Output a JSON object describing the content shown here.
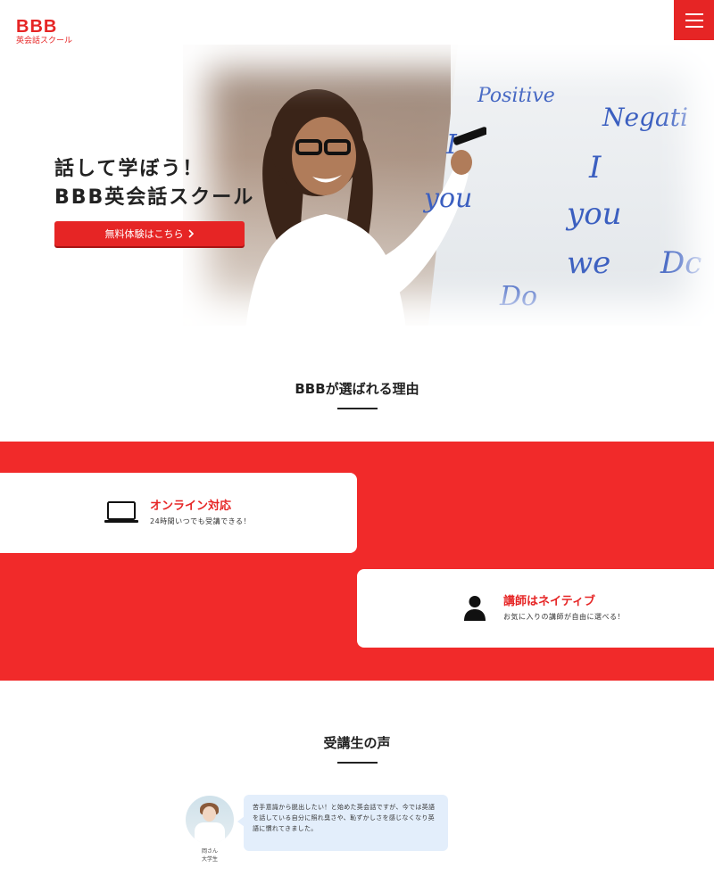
{
  "header": {
    "logo_main": "BBB",
    "logo_sub": "英会話スクール",
    "menu_icon": "hamburger-icon"
  },
  "colors": {
    "brand_red": "#e62525",
    "band_red": "#f12a2a",
    "bubble_blue": "#e3eefb"
  },
  "hero": {
    "title_line1": "話して学ぼう！",
    "title_line2": "BBB英会話スクール",
    "cta_label": "無料体験はこちら",
    "cta_icon": "chevron-right-icon"
  },
  "reasons": {
    "heading": "BBBが選ばれる理由",
    "items": [
      {
        "icon": "laptop-icon",
        "title": "オンライン対応",
        "desc": "24時間いつでも受講できる！"
      },
      {
        "icon": "person-icon",
        "title": "講師はネイティブ",
        "desc": "お気に入りの講師が自由に選べる！"
      }
    ]
  },
  "voices": {
    "heading": "受講生の声",
    "items": [
      {
        "name": "岡さん",
        "role": "大学生",
        "text": "苦手意識から脱出したい！と始めた英会話ですが、今では英語を話している自分に照れ臭さや、恥ずかしさを感じなくなり英語に慣れてきました。"
      }
    ]
  }
}
